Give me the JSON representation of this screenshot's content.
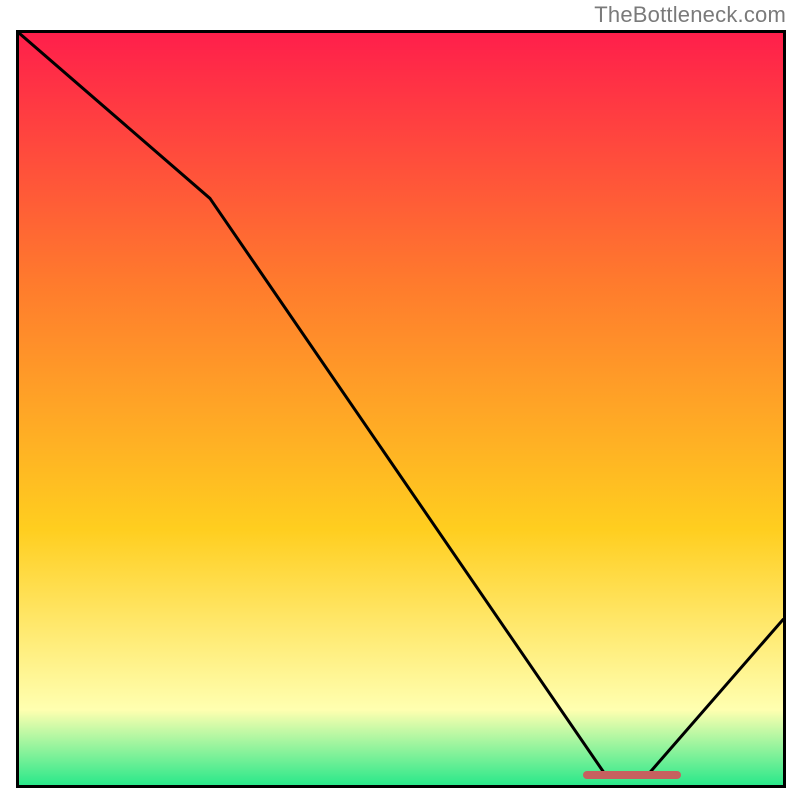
{
  "watermark": "TheBottleneck.com",
  "colors": {
    "top": "#ff1f4b",
    "mid1": "#ff7a2d",
    "mid2": "#ffce1f",
    "pale": "#ffffb0",
    "bottom": "#2ae88a",
    "curve": "#000000",
    "marker": "#c6615f"
  },
  "chart_data": {
    "type": "line",
    "title": "",
    "xlabel": "",
    "ylabel": "",
    "xlim": [
      0,
      100
    ],
    "ylim": [
      0,
      100
    ],
    "series": [
      {
        "name": "bottleneck-curve",
        "x": [
          0,
          25,
          77,
          82,
          100
        ],
        "values": [
          100,
          78,
          1,
          1,
          22
        ]
      }
    ],
    "annotations": [
      {
        "name": "optimal-range",
        "x_start": 74,
        "x_end": 87,
        "y": 1
      }
    ]
  }
}
